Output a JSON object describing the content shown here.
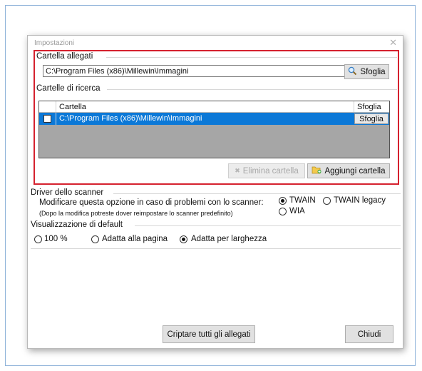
{
  "dialog": {
    "title": "Impostazioni",
    "close_symbol": "✕"
  },
  "attachments": {
    "group_label": "Cartella allegati",
    "path_value": "C:\\Program Files (x86)\\Millewin\\Immagini",
    "browse_label": "Sfoglia",
    "browse_icon": "search-icon"
  },
  "search_folders": {
    "group_label": "Cartelle di ricerca",
    "columns": [
      "Cartella",
      "Sfoglia"
    ],
    "rows": [
      {
        "checked": false,
        "path": "C:\\Program Files (x86)\\Millewin\\Immagini",
        "browse_label": "Sfoglia"
      }
    ],
    "delete_label": "Elimina cartella",
    "add_label": "Aggiungi cartella"
  },
  "scanner": {
    "group_label": "Driver dello scanner",
    "description": "Modificare questa opzione in caso di problemi con lo scanner:",
    "note": "(Dopo la modifica potreste dover reimpostare lo scanner predefinito)",
    "options": [
      "TWAIN",
      "TWAIN legacy",
      "WIA"
    ],
    "selected": "TWAIN"
  },
  "view": {
    "group_label": "Visualizzazione di default",
    "options": [
      "100 %",
      "Adatta alla pagina",
      "Adatta per larghezza"
    ],
    "selected": "Adatta per larghezza"
  },
  "footer": {
    "encrypt_label": "Criptare tutti gli allegati",
    "close_label": "Chiudi"
  },
  "colors": {
    "highlight": "#d5212e",
    "selection": "#0b78d7"
  }
}
